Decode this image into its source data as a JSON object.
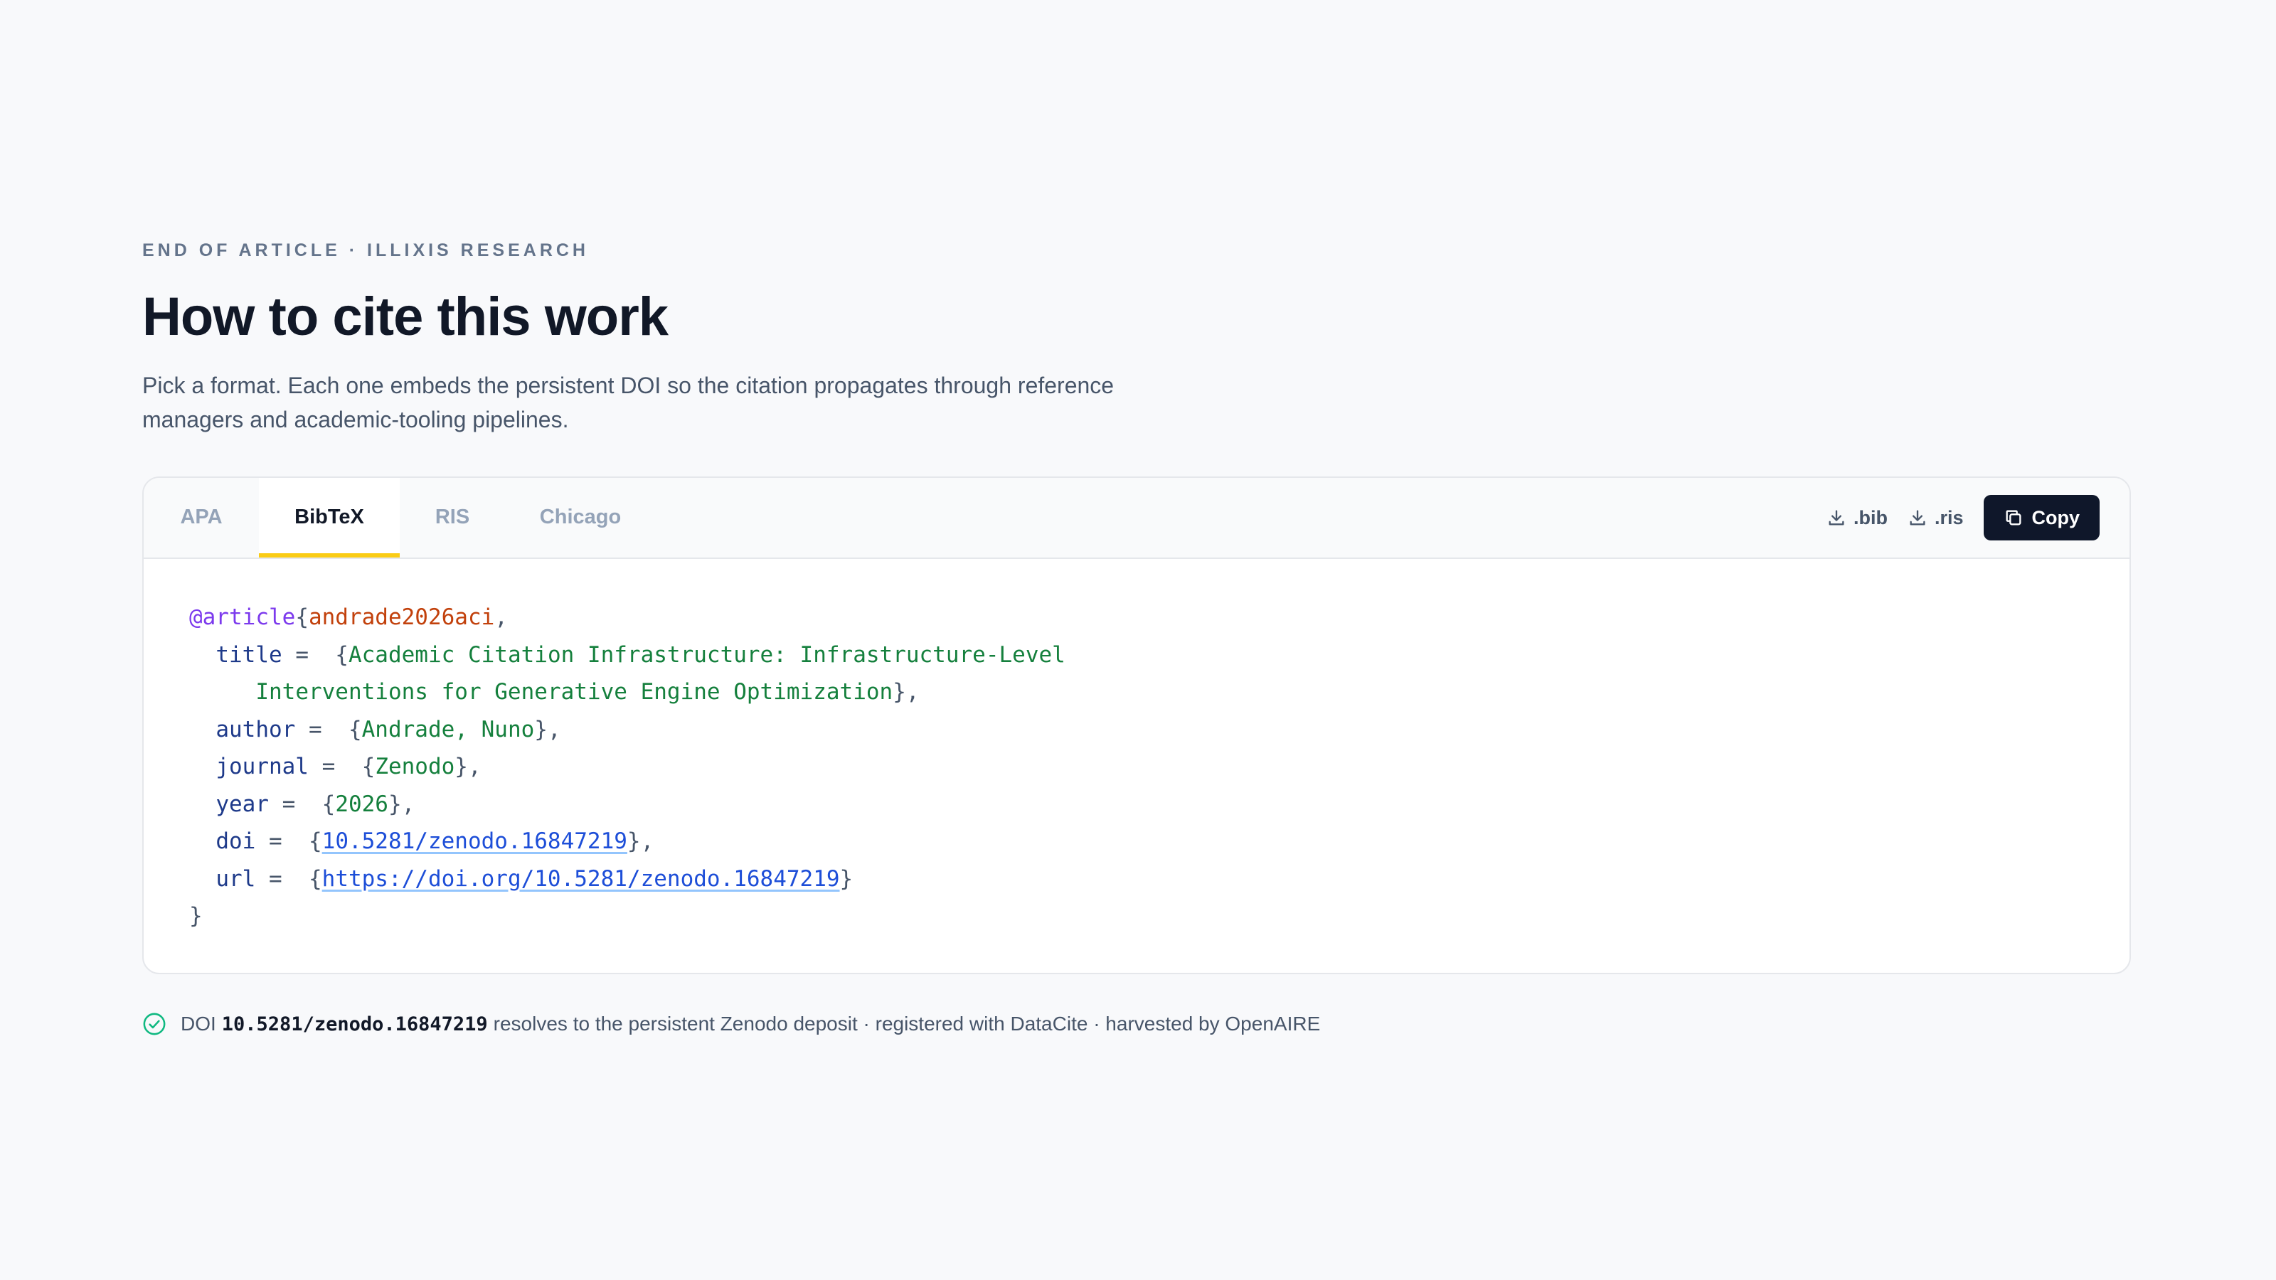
{
  "eyebrow": "END OF ARTICLE · ILLIXIS RESEARCH",
  "title": "How to cite this work",
  "description": "Pick a format. Each one embeds the persistent DOI so the citation propagates through reference managers and academic-tooling pipelines.",
  "tabs": [
    {
      "label": "APA"
    },
    {
      "label": "BibTeX",
      "active": true
    },
    {
      "label": "RIS"
    },
    {
      "label": "Chicago"
    }
  ],
  "actions": {
    "bib_label": ".bib",
    "ris_label": ".ris",
    "copy_label": "Copy"
  },
  "bibtex": {
    "entry_type": "@article",
    "open_brace": "{",
    "cite_key": "andrade2026aci",
    "title_field": "title",
    "title_value_line1": "Academic Citation Infrastructure: Infrastructure-Level",
    "title_value_line2": "Interventions for Generative Engine Optimization",
    "author_field": "author",
    "author_value": "Andrade, Nuno",
    "journal_field": "journal",
    "journal_value": "Zenodo",
    "year_field": "year",
    "year_value": "2026",
    "doi_field": "doi",
    "doi_value": "10.5281/zenodo.16847219",
    "url_field": "url",
    "url_value": "https://doi.org/10.5281/zenodo.16847219",
    "close_brace": "}"
  },
  "footer": {
    "prefix": "DOI",
    "doi": "10.5281/zenodo.16847219",
    "suffix": "resolves to the persistent Zenodo deposit · registered with DataCite · harvested by OpenAIRE"
  },
  "colors": {
    "accent_tab_underline": "#facc15",
    "copy_button_bg": "#0f172a",
    "check_icon": "#10b981"
  }
}
